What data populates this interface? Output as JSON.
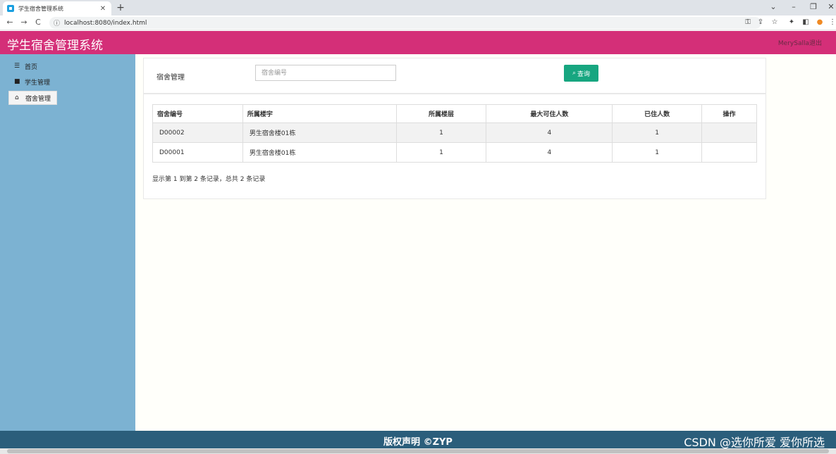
{
  "browser": {
    "tab_title": "学生宿舍管理系统",
    "tab_close": "✕",
    "new_tab": "+",
    "url": "localhost:8080/index.html",
    "nav_back": "←",
    "nav_forward": "→",
    "nav_reload": "C",
    "window_controls": [
      "⌄",
      "–",
      "❐",
      "✕"
    ]
  },
  "header": {
    "title": "学生宿舍管理系统",
    "user_link": "MerySalla退出",
    "bg_color": "#d42f78"
  },
  "sidebar": {
    "items": [
      {
        "icon": "☰",
        "label": "首页"
      },
      {
        "icon": "■",
        "label": "学生管理"
      },
      {
        "icon": "⌂",
        "label": "宿舍管理",
        "active": true
      }
    ]
  },
  "search": {
    "label": "宿舍管理",
    "placeholder": "宿舍编号",
    "button_label": "查询",
    "button_icon": "⌕"
  },
  "table": {
    "columns": [
      "宿舍编号",
      "所属楼宇",
      "所属楼层",
      "最大可住人数",
      "已住人数",
      "操作"
    ],
    "rows": [
      [
        "D00002",
        "男生宿舍楼01栋",
        "1",
        "4",
        "1",
        ""
      ],
      [
        "D00001",
        "男生宿舍楼01栋",
        "1",
        "4",
        "1",
        ""
      ]
    ],
    "pager_info": "显示第 1 到第 2 条记录，总共 2 条记录"
  },
  "footer": {
    "text": "版权声明 ©ZYP",
    "watermark": "CSDN @选你所爱 爱你所选"
  }
}
